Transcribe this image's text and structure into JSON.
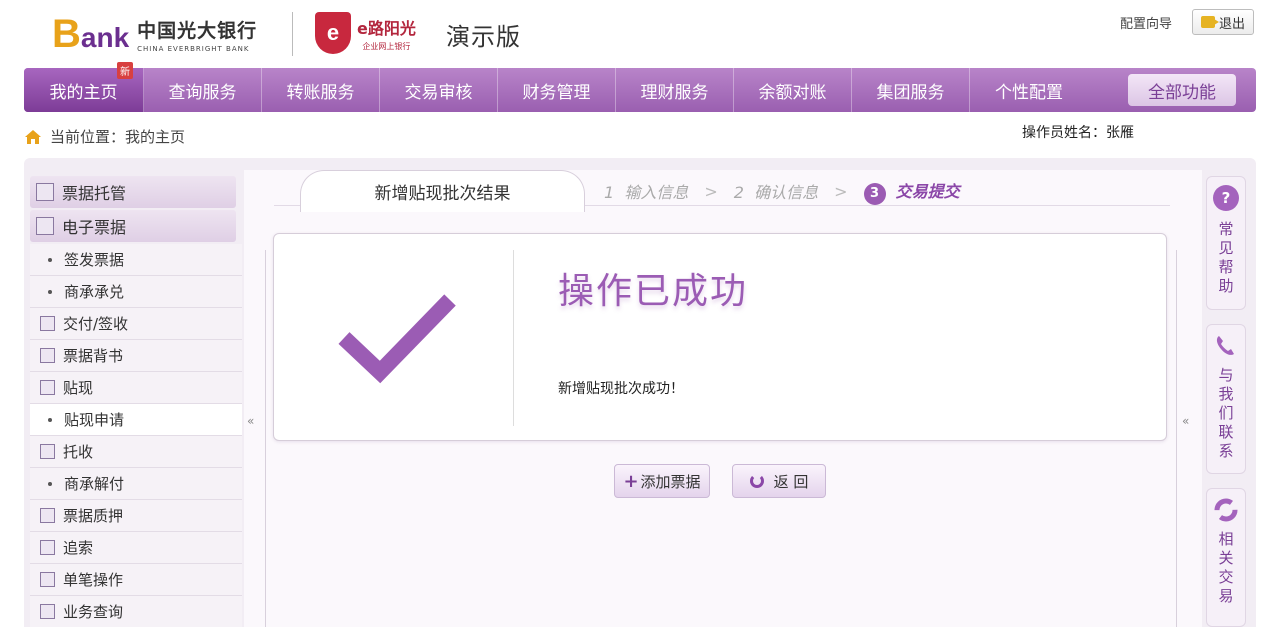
{
  "header": {
    "bank_logo_b": "B",
    "bank_logo_rest": "ank",
    "bank_name_cn": "中国光大银行",
    "bank_name_en": "CHINA EVERBRIGHT BANK",
    "ebank_mark": "e",
    "ebank_name": "e路阳光",
    "ebank_sub": "企业网上银行",
    "demo_label": "演示版",
    "config_guide": "配置向导",
    "logout": "退出"
  },
  "nav": {
    "items": [
      "我的主页",
      "查询服务",
      "转账服务",
      "交易审核",
      "财务管理",
      "理财服务",
      "余额对账",
      "集团服务",
      "个性配置"
    ],
    "new_badge": "新",
    "all_functions": "全部功能"
  },
  "breadcrumb": {
    "text": "当前位置：我的主页"
  },
  "operator": {
    "text": "操作员姓名：张雁"
  },
  "sidebar": {
    "groups": [
      {
        "label": "票据托管",
        "type": "head"
      },
      {
        "label": "电子票据",
        "type": "head"
      },
      {
        "label": "签发票据",
        "type": "bullet"
      },
      {
        "label": "商承承兑",
        "type": "bullet"
      },
      {
        "label": "交付/签收",
        "type": "square"
      },
      {
        "label": "票据背书",
        "type": "square"
      },
      {
        "label": "贴现",
        "type": "square"
      },
      {
        "label": "贴现申请",
        "type": "bullet",
        "selected": true
      },
      {
        "label": "托收",
        "type": "square"
      },
      {
        "label": "商承解付",
        "type": "bullet"
      },
      {
        "label": "票据质押",
        "type": "square"
      },
      {
        "label": "追索",
        "type": "square"
      },
      {
        "label": "单笔操作",
        "type": "square"
      },
      {
        "label": "业务查询",
        "type": "square"
      }
    ]
  },
  "tabs": {
    "active": "新增贴现批次结果",
    "steps": [
      {
        "num": "1",
        "label": "输入信息"
      },
      {
        "num": "2",
        "label": "确认信息"
      },
      {
        "num": "3",
        "label": "交易提交"
      }
    ],
    "sep": ">"
  },
  "result": {
    "title": "操作已成功",
    "message": "新增贴现批次成功！"
  },
  "buttons": {
    "add_bill": "添加票据",
    "back": "返 回"
  },
  "rail": {
    "help_icon": "?",
    "help": "常见帮助",
    "contact": "与我们联系",
    "related": "相关交易"
  },
  "colors": {
    "brand_purple": "#9a5fb0",
    "brand_gold": "#e8a21a",
    "success_purple": "#9b5cb4"
  }
}
